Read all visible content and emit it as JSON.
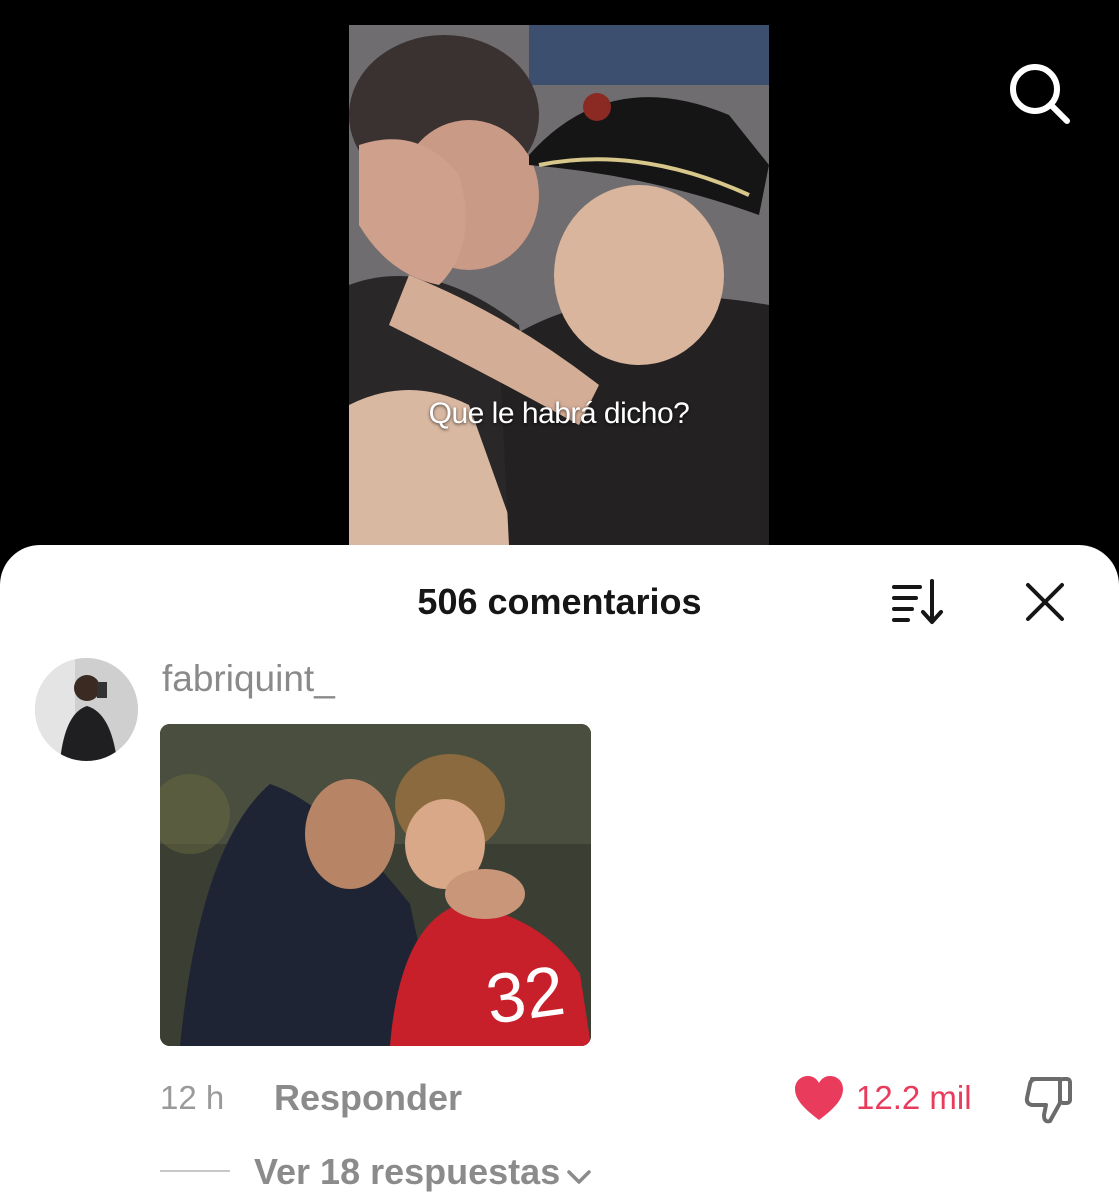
{
  "video": {
    "caption": "Que le habrá dicho?"
  },
  "icons": {
    "search": "search-icon",
    "sort": "sort-icon",
    "close": "close-icon",
    "like": "heart-icon",
    "dislike": "thumbs-down-icon",
    "chevron": "chevron-down-icon"
  },
  "comments_panel": {
    "title": "506 comentarios"
  },
  "comment": {
    "username": "fabriquint_",
    "timestamp": "12 h",
    "reply_label": "Responder",
    "like_count": "12.2 mil",
    "replies_label": "Ver 18 respuestas"
  },
  "colors": {
    "accent_like": "#e93c5d",
    "muted_text": "#8b8b8b",
    "title_text": "#161616"
  }
}
